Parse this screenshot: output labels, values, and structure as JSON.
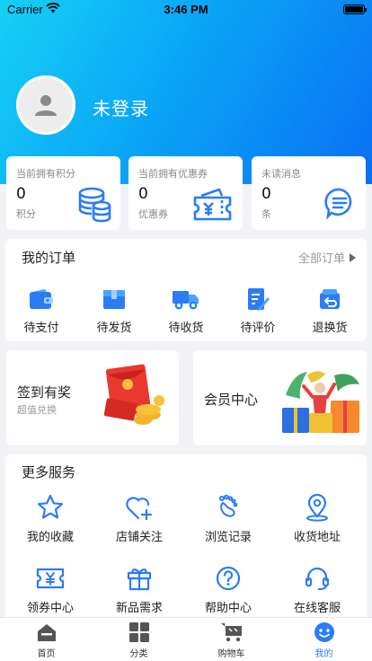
{
  "status_bar": {
    "carrier": "Carrier",
    "time": "3:46 PM"
  },
  "profile": {
    "login_text": "未登录"
  },
  "stats": [
    {
      "label": "当前拥有积分",
      "value": "0",
      "unit": "积分",
      "icon": "coins-stack-icon"
    },
    {
      "label": "当前拥有优惠券",
      "value": "0",
      "unit": "优惠券",
      "icon": "coupon-ticket-icon"
    },
    {
      "label": "未读消息",
      "value": "0",
      "unit": "条",
      "icon": "message-bubble-icon"
    }
  ],
  "orders": {
    "title": "我的订单",
    "all_label": "全部订单",
    "items": [
      {
        "label": "待支付",
        "icon": "wallet-icon"
      },
      {
        "label": "待发货",
        "icon": "package-box-icon"
      },
      {
        "label": "待收货",
        "icon": "delivery-truck-icon"
      },
      {
        "label": "待评价",
        "icon": "edit-note-icon"
      },
      {
        "label": "退换货",
        "icon": "return-box-icon"
      }
    ]
  },
  "promos": {
    "signin": {
      "title": "签到有奖",
      "subtitle": "超值兑换",
      "icon": "red-envelope-coins-icon"
    },
    "member": {
      "title": "会员中心",
      "icon": "member-gifts-icon"
    }
  },
  "services": {
    "title": "更多服务",
    "items": [
      {
        "label": "我的收藏",
        "icon": "star-icon"
      },
      {
        "label": "店铺关注",
        "icon": "heart-plus-icon"
      },
      {
        "label": "浏览记录",
        "icon": "footprint-icon"
      },
      {
        "label": "收货地址",
        "icon": "location-pin-icon"
      },
      {
        "label": "领券中心",
        "icon": "coupon-yen-icon"
      },
      {
        "label": "新品需求",
        "icon": "gift-box-icon"
      },
      {
        "label": "帮助中心",
        "icon": "help-circle-icon"
      },
      {
        "label": "在线客服",
        "icon": "headset-icon"
      }
    ]
  },
  "tabbar": [
    {
      "label": "首页",
      "icon": "home-icon",
      "active": false
    },
    {
      "label": "分类",
      "icon": "grid-icon",
      "active": false
    },
    {
      "label": "购物车",
      "icon": "cart-icon",
      "active": false
    },
    {
      "label": "我的",
      "icon": "smiley-icon",
      "active": true
    }
  ],
  "colors": {
    "accent": "#2b7cf6",
    "header_start": "#16d0f5",
    "header_end": "#0a70f2"
  }
}
